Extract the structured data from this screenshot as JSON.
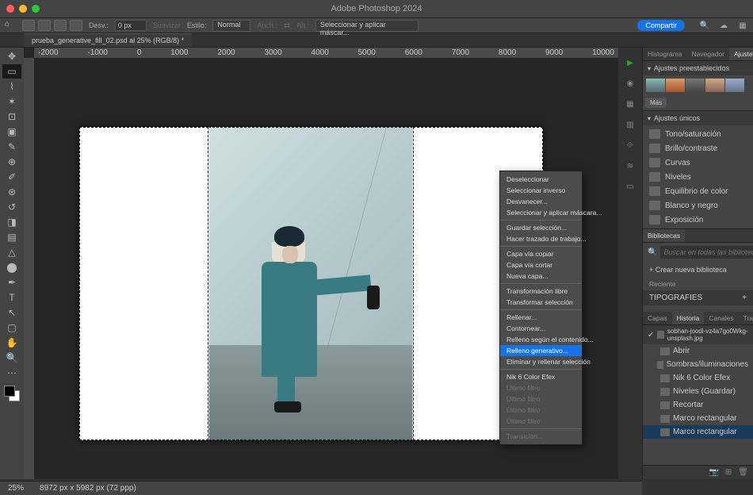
{
  "app_title": "Adobe Photoshop 2024",
  "optbar": {
    "desv_label": "Desv.:",
    "desv_value": "0 px",
    "suavizar": "Suavizar",
    "estilo_label": "Estilo:",
    "estilo_value": "Normal",
    "anch": "Anch.:",
    "alt": "Alt.:",
    "sel_mask": "Seleccionar y aplicar máscar...",
    "share": "Compartir"
  },
  "doc_tab": "prueba_generative_fill_02.psd al 25% (RGB/8) *",
  "ruler_marks": [
    "-2000",
    "-1000",
    "0",
    "1000",
    "2000",
    "3000",
    "4000",
    "5000",
    "6000",
    "7000",
    "8000",
    "9000",
    "10000"
  ],
  "context": [
    {
      "t": "Deseleccionar"
    },
    {
      "t": "Seleccionar inverso"
    },
    {
      "t": "Desvanecer..."
    },
    {
      "t": "Seleccionar y aplicar máscara..."
    },
    {
      "sep": true
    },
    {
      "t": "Guardar selección..."
    },
    {
      "t": "Hacer trazado de trabajo..."
    },
    {
      "sep": true
    },
    {
      "t": "Capa vía copiar"
    },
    {
      "t": "Capa vía cortar"
    },
    {
      "t": "Nueva capa..."
    },
    {
      "sep": true
    },
    {
      "t": "Transformación libre"
    },
    {
      "t": "Transformar selección"
    },
    {
      "sep": true
    },
    {
      "t": "Rellenar..."
    },
    {
      "t": "Contornear..."
    },
    {
      "t": "Relleno según el contenido..."
    },
    {
      "t": "Relleno generativo...",
      "hl": true
    },
    {
      "t": "Eliminar y rellenar selección"
    },
    {
      "sep": true
    },
    {
      "t": "Nik 6 Color Efex"
    },
    {
      "t": "Último filtro",
      "dis": true
    },
    {
      "t": "Último filtro",
      "dis": true
    },
    {
      "t": "Último filtro",
      "dis": true
    },
    {
      "t": "Último filtro",
      "dis": true
    },
    {
      "sep": true
    },
    {
      "t": "Transición...",
      "dis": true
    }
  ],
  "panels": {
    "top_tabs": [
      "Histograma",
      "Navegador",
      "Ajustes"
    ],
    "presets_head": "Ajustes preestablecidos",
    "mas": "Más",
    "unique_head": "Ajustes únicos",
    "adjustments": [
      "Tono/saturación",
      "Brillo/contraste",
      "Curvas",
      "Niveles",
      "Equilibrio de color",
      "Blanco y negro",
      "Exposición"
    ],
    "bibliotecas": "Bibliotecas",
    "search_ph": "Buscar en todas las bibliotecas",
    "new_lib": "+ Crear nueva biblioteca",
    "reciente": "Reciente",
    "tipografies": "TIPOGRAFIES",
    "hist_tabs": [
      "Capas",
      "Historia",
      "Canales",
      "Trazados"
    ],
    "hist_root": "sobhan-joodi-vz4a7go0Wkg-unsplash.jpg",
    "history": [
      "Abrir",
      "Sombras/iluminaciones",
      "Nik 6 Color Efex",
      "Niveles (Guardar)",
      "Recortar",
      "Marco rectangular",
      "Marco rectangular"
    ]
  },
  "status": {
    "zoom": "25%",
    "dims": "8972 px x 5982 px (72 ppp)"
  }
}
